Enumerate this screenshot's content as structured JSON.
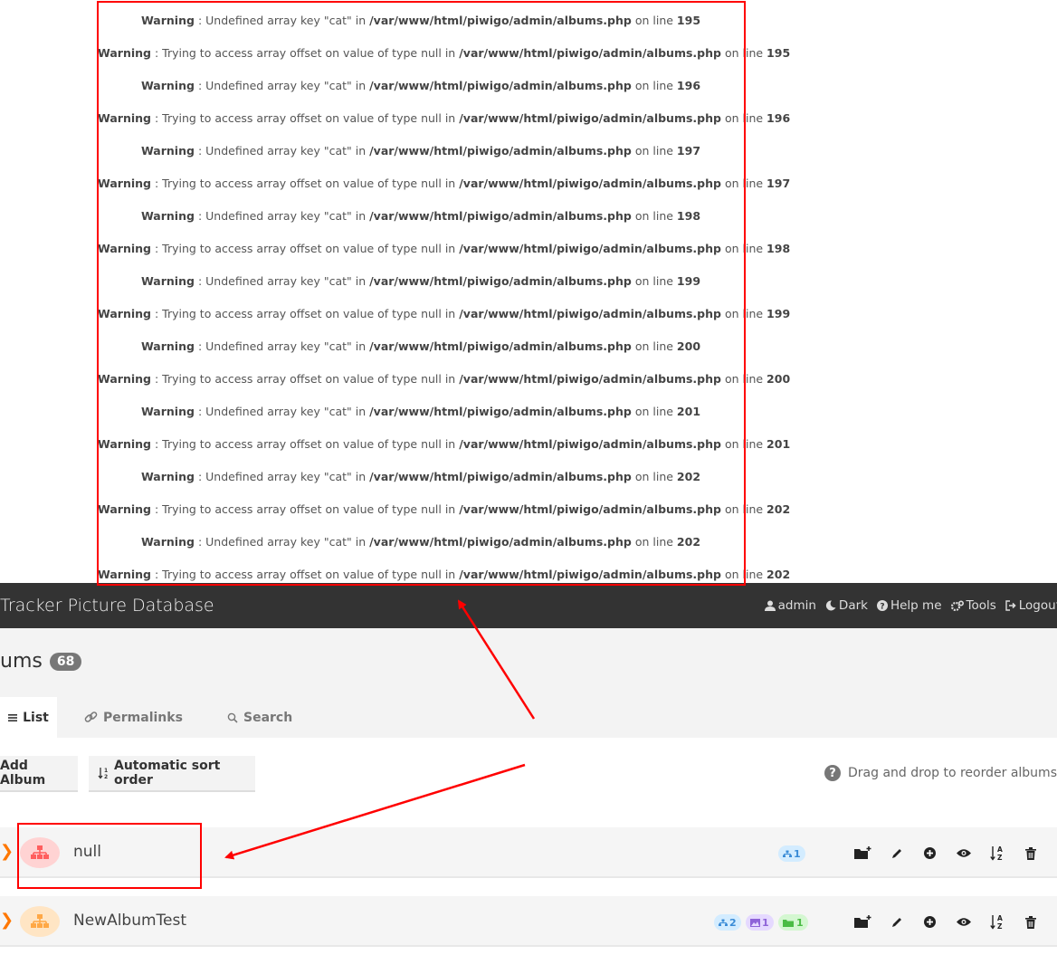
{
  "warnings": [
    {
      "kind": "Warning",
      "message": "Undefined array key \"cat\" in",
      "file": "/var/www/html/piwigo/admin/albums.php",
      "on_line": "on line",
      "line": "195"
    },
    {
      "kind": "Warning",
      "message": "Trying to access array offset on value of type null in",
      "file": "/var/www/html/piwigo/admin/albums.php",
      "on_line": "on line",
      "line": "195"
    },
    {
      "kind": "Warning",
      "message": "Undefined array key \"cat\" in",
      "file": "/var/www/html/piwigo/admin/albums.php",
      "on_line": "on line",
      "line": "196"
    },
    {
      "kind": "Warning",
      "message": "Trying to access array offset on value of type null in",
      "file": "/var/www/html/piwigo/admin/albums.php",
      "on_line": "on line",
      "line": "196"
    },
    {
      "kind": "Warning",
      "message": "Undefined array key \"cat\" in",
      "file": "/var/www/html/piwigo/admin/albums.php",
      "on_line": "on line",
      "line": "197"
    },
    {
      "kind": "Warning",
      "message": "Trying to access array offset on value of type null in",
      "file": "/var/www/html/piwigo/admin/albums.php",
      "on_line": "on line",
      "line": "197"
    },
    {
      "kind": "Warning",
      "message": "Undefined array key \"cat\" in",
      "file": "/var/www/html/piwigo/admin/albums.php",
      "on_line": "on line",
      "line": "198"
    },
    {
      "kind": "Warning",
      "message": "Trying to access array offset on value of type null in",
      "file": "/var/www/html/piwigo/admin/albums.php",
      "on_line": "on line",
      "line": "198"
    },
    {
      "kind": "Warning",
      "message": "Undefined array key \"cat\" in",
      "file": "/var/www/html/piwigo/admin/albums.php",
      "on_line": "on line",
      "line": "199"
    },
    {
      "kind": "Warning",
      "message": "Trying to access array offset on value of type null in",
      "file": "/var/www/html/piwigo/admin/albums.php",
      "on_line": "on line",
      "line": "199"
    },
    {
      "kind": "Warning",
      "message": "Undefined array key \"cat\" in",
      "file": "/var/www/html/piwigo/admin/albums.php",
      "on_line": "on line",
      "line": "200"
    },
    {
      "kind": "Warning",
      "message": "Trying to access array offset on value of type null in",
      "file": "/var/www/html/piwigo/admin/albums.php",
      "on_line": "on line",
      "line": "200"
    },
    {
      "kind": "Warning",
      "message": "Undefined array key \"cat\" in",
      "file": "/var/www/html/piwigo/admin/albums.php",
      "on_line": "on line",
      "line": "201"
    },
    {
      "kind": "Warning",
      "message": "Trying to access array offset on value of type null in",
      "file": "/var/www/html/piwigo/admin/albums.php",
      "on_line": "on line",
      "line": "201"
    },
    {
      "kind": "Warning",
      "message": "Undefined array key \"cat\" in",
      "file": "/var/www/html/piwigo/admin/albums.php",
      "on_line": "on line",
      "line": "202"
    },
    {
      "kind": "Warning",
      "message": "Trying to access array offset on value of type null in",
      "file": "/var/www/html/piwigo/admin/albums.php",
      "on_line": "on line",
      "line": "202"
    },
    {
      "kind": "Warning",
      "message": "Undefined array key \"cat\" in",
      "file": "/var/www/html/piwigo/admin/albums.php",
      "on_line": "on line",
      "line": "202"
    },
    {
      "kind": "Warning",
      "message": "Trying to access array offset on value of type null in",
      "file": "/var/www/html/piwigo/admin/albums.php",
      "on_line": "on line",
      "line": "202"
    }
  ],
  "header": {
    "site_title": "Tracker Picture Database",
    "menu": [
      {
        "label": "admin",
        "icon": "user-icon"
      },
      {
        "label": "Dark",
        "icon": "moon-icon"
      },
      {
        "label": "Help me",
        "icon": "question-circle-icon"
      },
      {
        "label": "Tools",
        "icon": "gears-icon"
      },
      {
        "label": "Logout",
        "icon": "sign-out-icon"
      }
    ]
  },
  "page": {
    "title": "ums",
    "album_count": "68"
  },
  "tabs": [
    {
      "label": "List",
      "icon": "list-icon",
      "active": true
    },
    {
      "label": "Permalinks",
      "icon": "link-icon",
      "active": false
    },
    {
      "label": "Search",
      "icon": "search-icon",
      "active": false
    }
  ],
  "toolbar": {
    "add_album_label": "Add Album",
    "sort_order_label": "Automatic sort order",
    "drag_hint": "Drag and drop to reorder albums"
  },
  "albums": [
    {
      "name": "null",
      "icon_color": "#ff5e5e",
      "icon_bg": "#ffd3d3",
      "badges": [
        {
          "type": "sub-albums",
          "value": "1"
        }
      ]
    },
    {
      "name": "NewAlbumTest",
      "icon_color": "#ffa846",
      "icon_bg": "#ffe5c4",
      "badges": [
        {
          "type": "sub-albums",
          "value": "2"
        },
        {
          "type": "images",
          "value": "1"
        },
        {
          "type": "sub-images",
          "value": "1"
        }
      ]
    }
  ],
  "row_action_icons": [
    "add-sub-album-icon",
    "edit-pencil-icon",
    "plus-circle-icon",
    "eye-icon",
    "sort-alpha-icon",
    "trash-icon"
  ],
  "colors": {
    "header_bg": "#333333",
    "annotation_red": "#ff0000",
    "chevron_orange": "#ff7700"
  }
}
